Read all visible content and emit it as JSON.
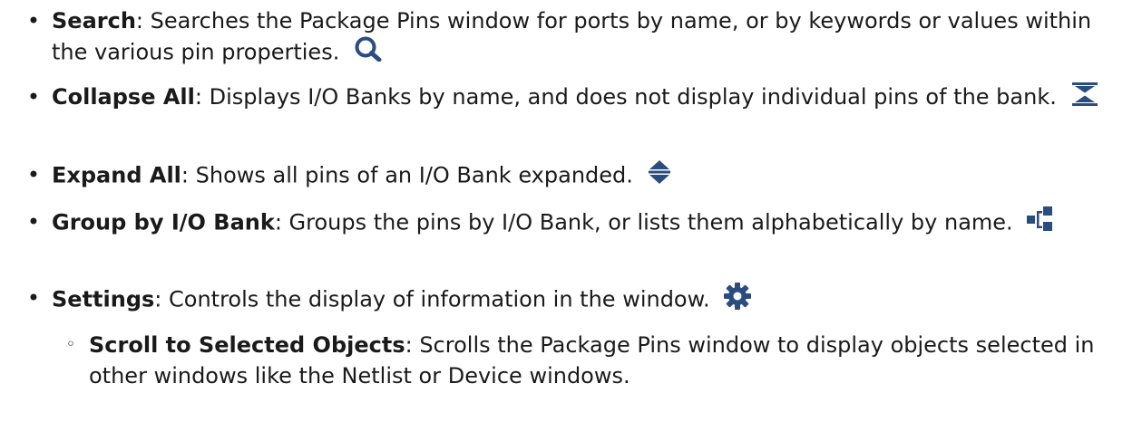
{
  "items": [
    {
      "term": "Search",
      "desc": ": Searches the Package Pins window for ports by name, or by keywords or values within the various pin properties.",
      "icon": "search-icon"
    },
    {
      "term": "Collapse All",
      "desc": ": Displays I/O Banks by name, and does not display individual pins of the bank.",
      "icon": "collapse-all-icon"
    },
    {
      "term": "Expand All",
      "desc": ": Shows all pins of an I/O Bank expanded.",
      "icon": "expand-all-icon"
    },
    {
      "term": "Group by I/O Bank",
      "desc": ": Groups the pins by I/O Bank, or lists them alphabetically by name.",
      "icon": "group-by-bank-icon"
    },
    {
      "term": "Settings",
      "desc": ": Controls the display of information in the window.",
      "icon": "gear-icon"
    }
  ],
  "sub_items": [
    {
      "term": "Scroll to Selected Objects",
      "desc": ": Scrolls the Package Pins window to display objects selected in other windows like the Netlist or Device windows."
    }
  ],
  "bullet": "•",
  "sub_bullet": "◦",
  "icon_color": "#2a4d80"
}
